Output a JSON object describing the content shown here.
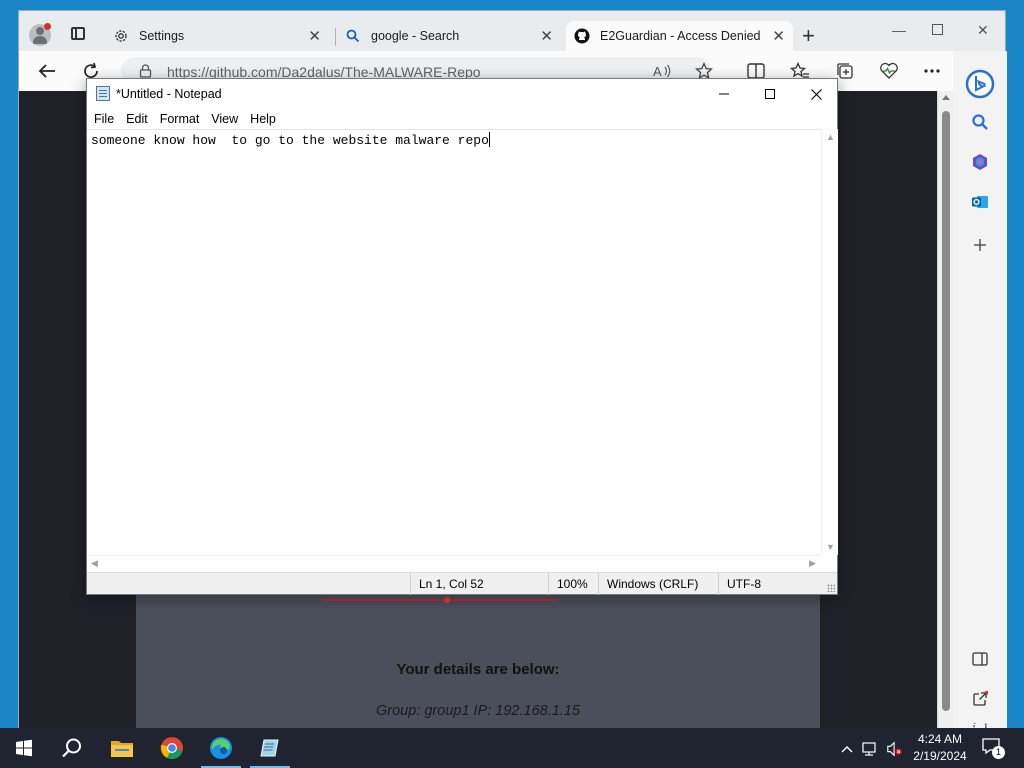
{
  "browser": {
    "tabs": [
      {
        "label": "Settings",
        "icon": "gear-icon",
        "active": false
      },
      {
        "label": "google - Search",
        "icon": "search-icon",
        "active": false
      },
      {
        "label": "E2Guardian - Access Denied",
        "icon": "github-icon",
        "active": true
      }
    ],
    "address_url": "https://github.com/Da2dalus/The-MALWARE-Repo",
    "page": {
      "heading": "Your details are below:",
      "details": "Group: group1   IP: 192.168.1.15"
    }
  },
  "notepad": {
    "title": "*Untitled - Notepad",
    "menu": [
      "File",
      "Edit",
      "Format",
      "View",
      "Help"
    ],
    "content": "someone know how  to go to the website malware repo",
    "status": {
      "position": "Ln 1, Col 52",
      "zoom": "100%",
      "line_endings": "Windows (CRLF)",
      "encoding": "UTF-8"
    }
  },
  "taskbar": {
    "time": "4:24 AM",
    "date": "2/19/2024",
    "notification_count": "1"
  },
  "colors": {
    "accent": "#0078d4",
    "taskbar": "#1f2430",
    "page_background": "#1f2128",
    "panel": "#4b4f5c"
  }
}
